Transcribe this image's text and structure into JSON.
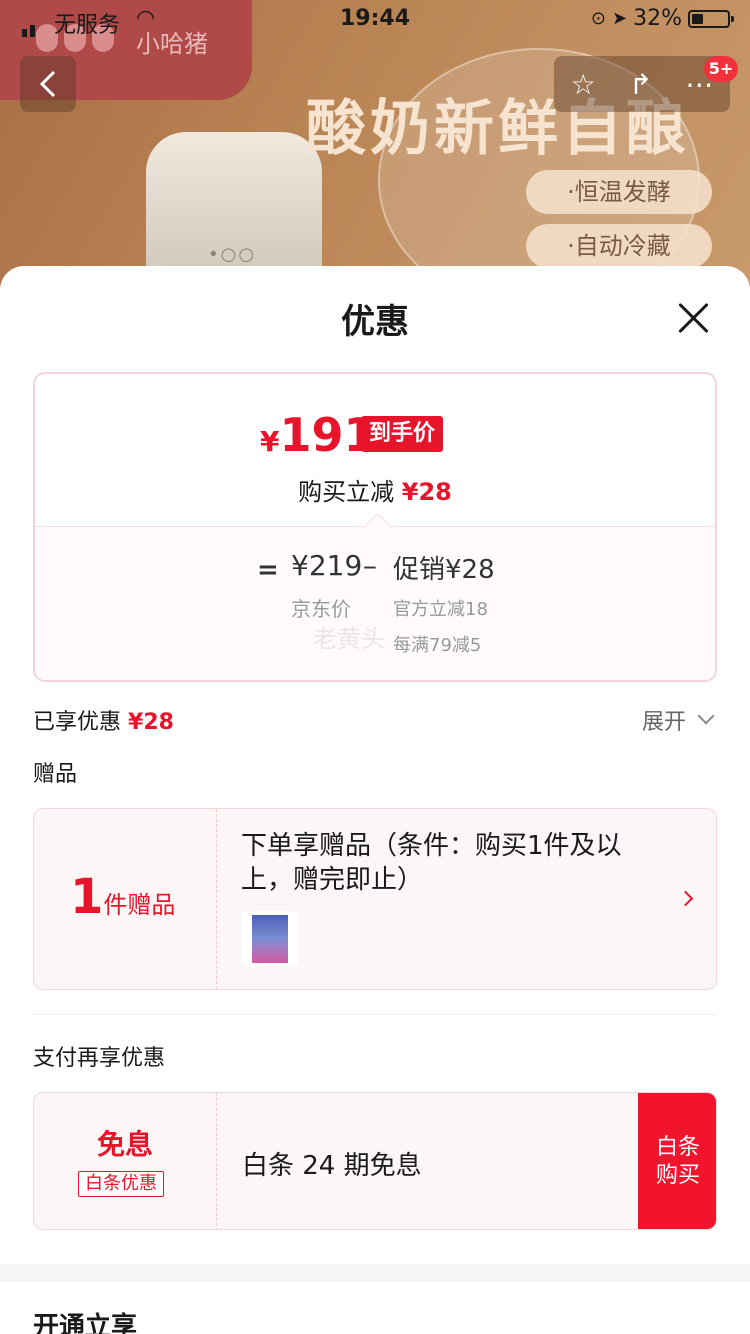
{
  "status_bar": {
    "carrier": "无服务",
    "time": "19:44",
    "battery": "32%",
    "battery_level": 0.32
  },
  "background": {
    "brand": "小哈猪",
    "headline": "酸奶新鲜自酿",
    "pills": [
      "·恒温发酵",
      "·自动冷藏"
    ]
  },
  "nav": {
    "badge": "5+"
  },
  "sheet": {
    "title": "优惠",
    "price_card": {
      "currency": "¥",
      "final_price": "191",
      "final_tag": "到手价",
      "reduce_label": "购买立减",
      "reduce_amount": "¥28",
      "equals": "=",
      "jd_price": "¥219",
      "minus": "–",
      "promo": "促销¥28",
      "jd_label": "京东价",
      "promo_lines": [
        "官方立减18",
        "每满79减5"
      ],
      "watermark": "老黄头"
    },
    "enjoyed": {
      "label": "已享优惠",
      "amount": "¥28",
      "expand": "展开"
    },
    "gift": {
      "heading": "赠品",
      "count": "1",
      "unit": "件赠品",
      "description": "下单享赠品（条件：购买1件及以上，赠完即止）"
    },
    "payment": {
      "heading": "支付再享优惠",
      "badge_main": "免息",
      "badge_tag": "白条优惠",
      "text": "白条 24 期免息",
      "button": "白条\n购买"
    },
    "next_section": "开通立享"
  },
  "colors": {
    "accent_red": "#e8142c",
    "button_red": "#f2142c"
  }
}
